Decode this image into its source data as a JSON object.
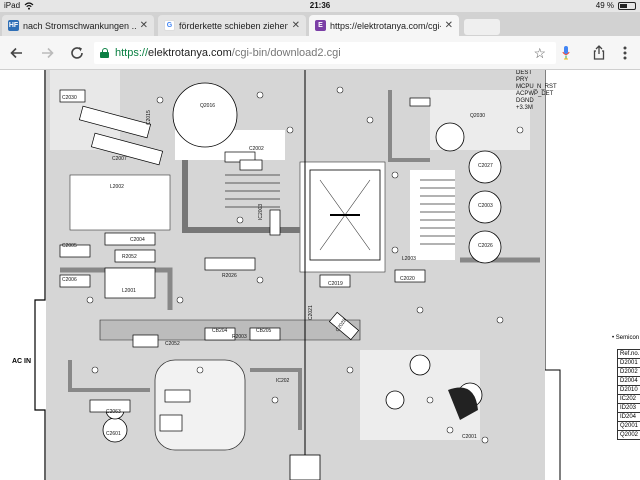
{
  "status_bar": {
    "carrier": "iPad",
    "time": "21:36",
    "battery_percent": "49 %",
    "battery_level": 0.49
  },
  "tabs": [
    {
      "favicon": "HF",
      "favicon_color": "#2f6fb6",
      "title": "nach Stromschwankungen ...",
      "active": false
    },
    {
      "favicon": "G",
      "favicon_color": "#4285f4",
      "title": "förderkette schieben ziehen",
      "active": false
    },
    {
      "favicon": "E",
      "favicon_color": "#7b3fa6",
      "title": "https://elektrotanya.com/cgi-",
      "active": true
    }
  ],
  "toolbar": {
    "back_icon": "arrow-left-icon",
    "forward_icon": "arrow-right-icon",
    "reload_icon": "reload-icon",
    "url_scheme": "https://",
    "url_host": "elektrotanya.com",
    "url_path": "/cgi-bin/download2.cgi",
    "bookmark_icon": "star-icon",
    "mic_icon": "mic-icon",
    "share_icon": "share-icon",
    "menu_icon": "more-vertical-icon"
  },
  "schematic": {
    "signal_labels": [
      "DEST",
      "PRY",
      "MCPU_N_RST",
      "ACPWP_DET",
      "DGND",
      "+3.3M"
    ],
    "component_labels": {
      "c2030": "C2030",
      "c2015": "C2015",
      "q2016": "Q2016",
      "c2007": "C2007",
      "l2002": "L2002",
      "c2005": "C2005",
      "c2004": "C2004",
      "r2052": "R2052",
      "c2006": "C2006",
      "l2001": "L2001",
      "c2002": "C2002",
      "ic2003": "IC2003",
      "r2026": "R2026",
      "q2030": "Q2030",
      "c2027": "C2027",
      "l2003": "L2003",
      "c2020": "C2020",
      "c2003": "C2003",
      "c2019": "C2019",
      "c2028": "C2028",
      "cb204": "CB204",
      "r2003": "R2003",
      "cb205": "CB205",
      "c2052": "C2052",
      "c2063": "C2063",
      "c2601": "C2601",
      "ic202": "IC202",
      "c2026": "C2026",
      "c2021": "C2021",
      "c2001": "C2001"
    },
    "ac_in_label": "AC IN",
    "semiconductor_heading": "• Semicon",
    "ref_table": [
      "Ref.no.",
      "D2001",
      "D2002",
      "D2004",
      "D2010",
      "IC202",
      "ID203",
      "ID204",
      "Q2001",
      "Q2002"
    ]
  }
}
